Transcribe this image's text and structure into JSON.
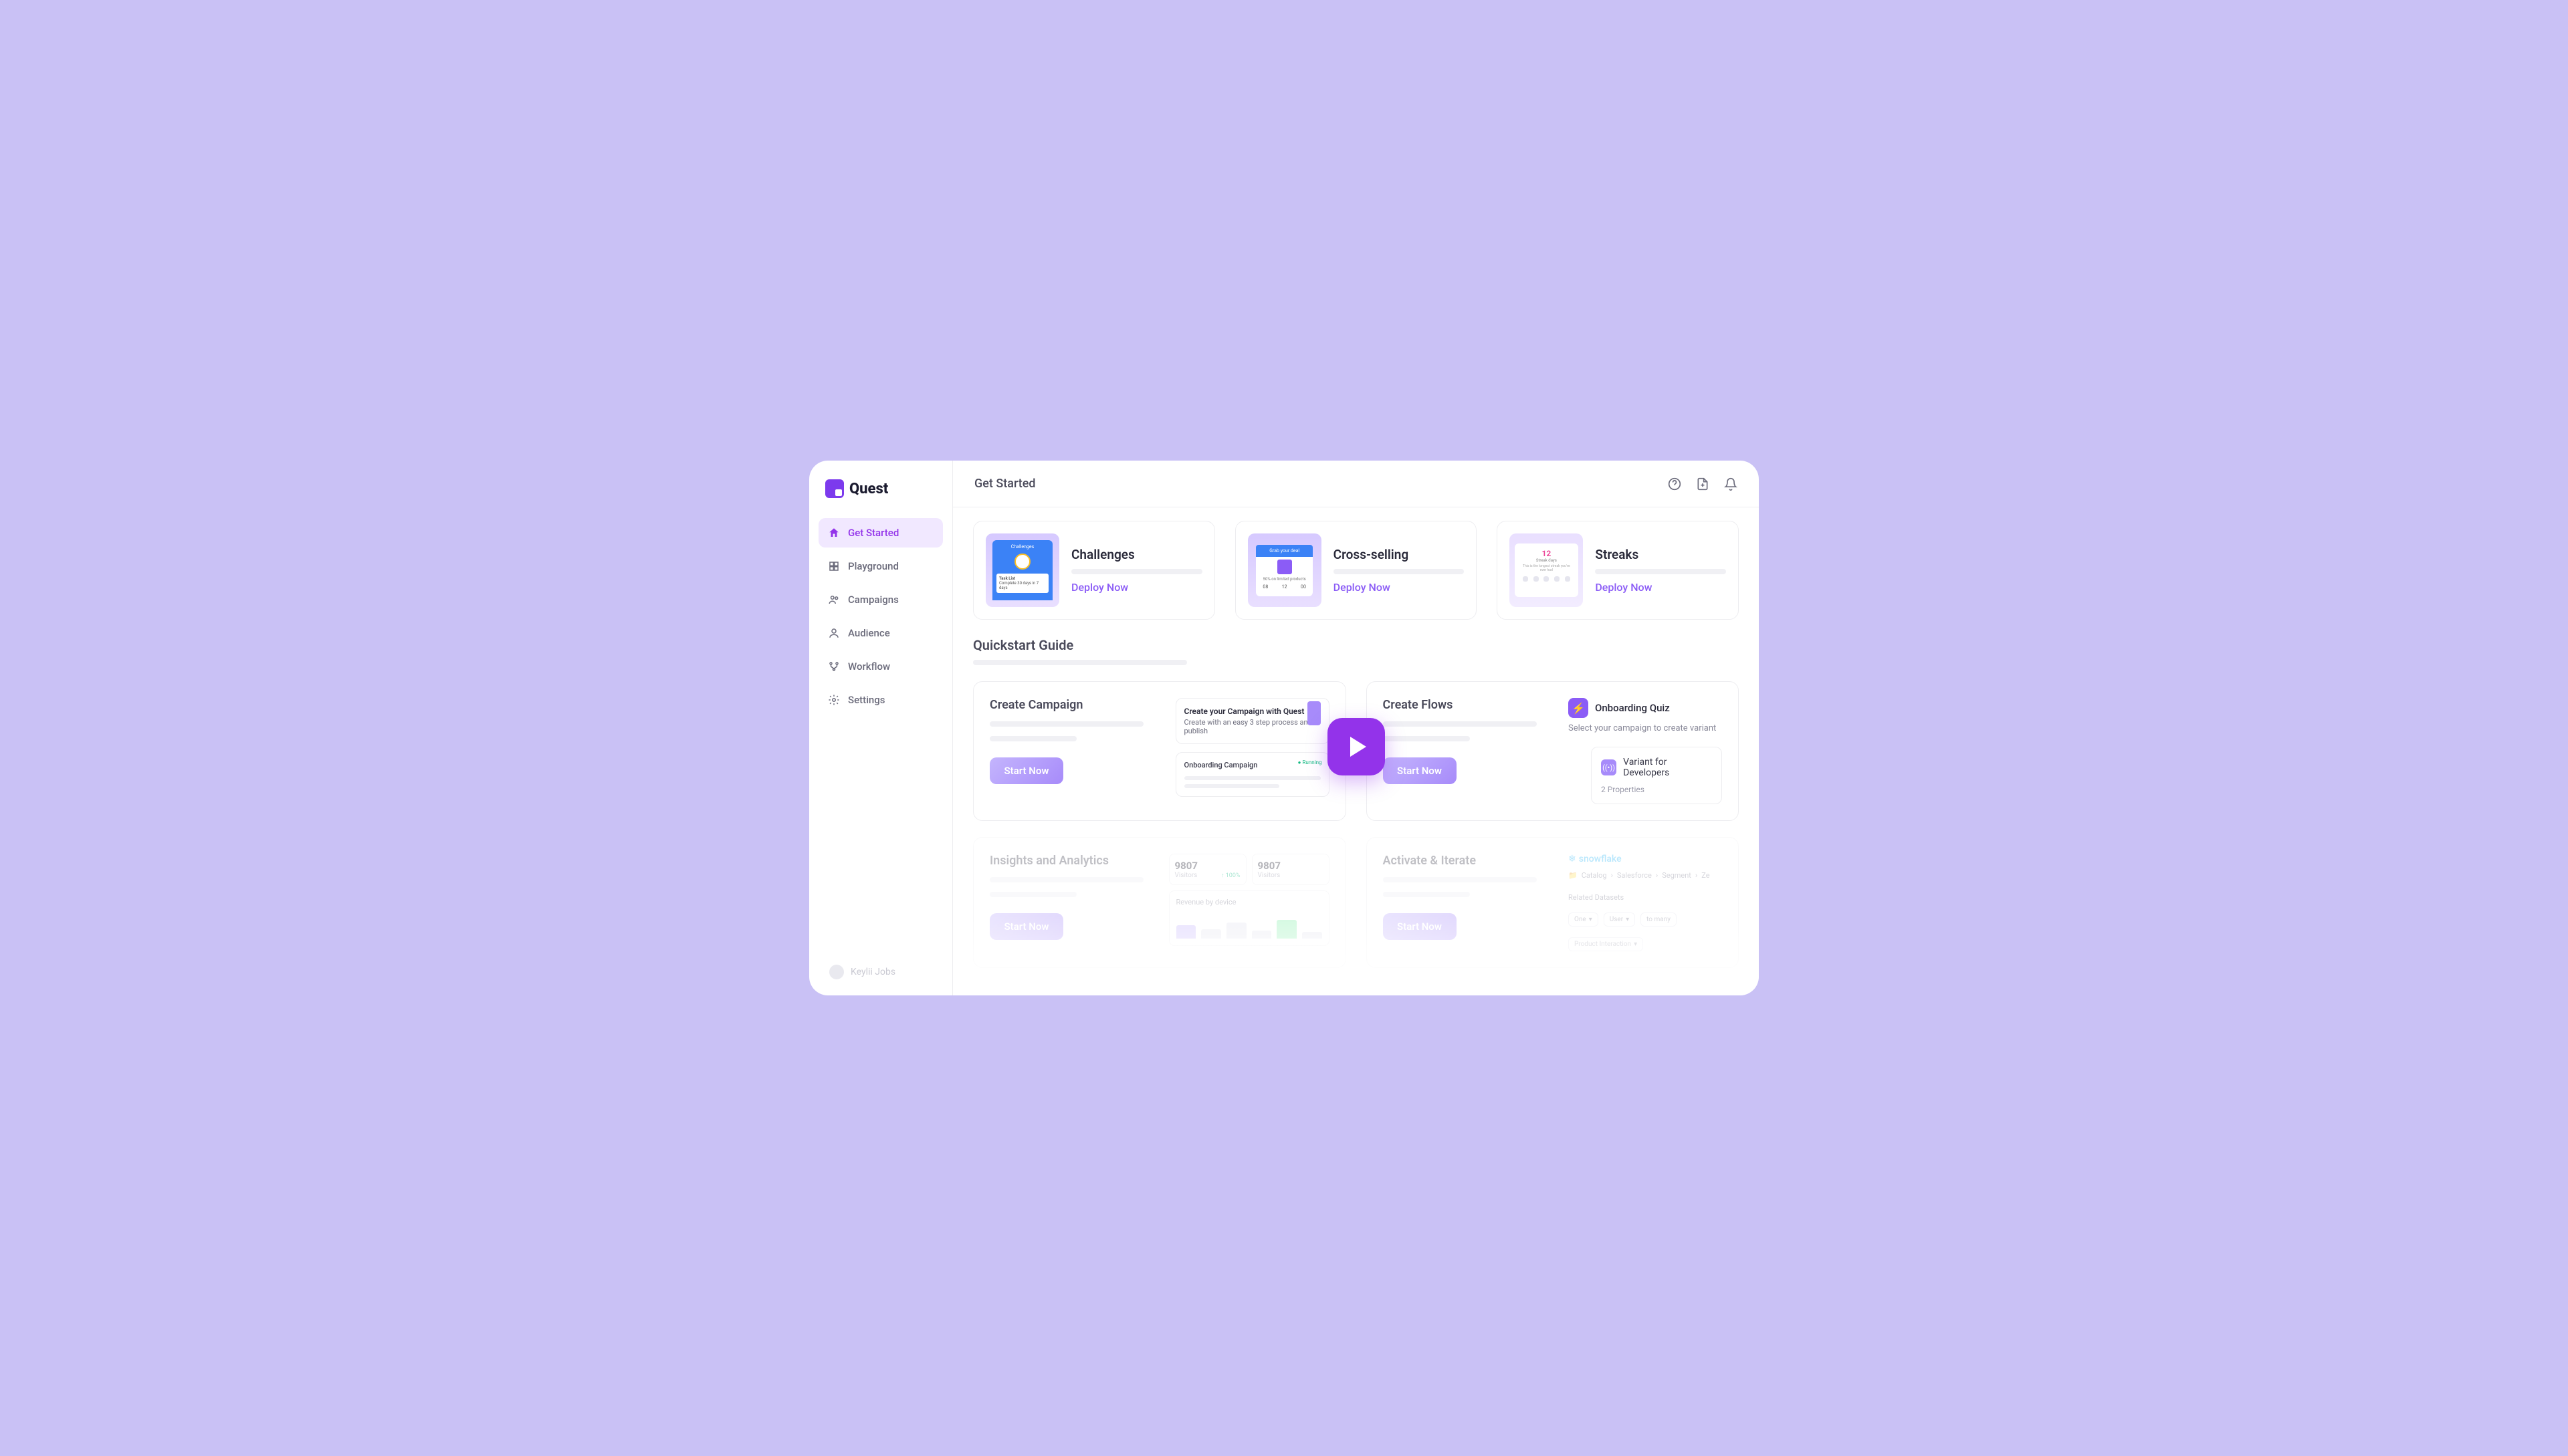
{
  "brand": "Quest",
  "header": {
    "title": "Get Started"
  },
  "nav": {
    "get_started": "Get Started",
    "playground": "Playground",
    "campaigns": "Campaigns",
    "audience": "Audience",
    "workflow": "Workflow",
    "settings": "Settings"
  },
  "user": {
    "name": "Keylii Jobs"
  },
  "cards": {
    "challenges": {
      "title": "Challenges",
      "cta": "Deploy Now",
      "thumb_label": "Challenges",
      "task_title": "Task List",
      "task_sub": "Complete 30 days in 7 days"
    },
    "cross_selling": {
      "title": "Cross-selling",
      "cta": "Deploy Now",
      "thumb_top": "Grab your deal",
      "thumb_deal": "50% on limited products",
      "t1": "08",
      "t2": "12",
      "t3": "00"
    },
    "streaks": {
      "title": "Streaks",
      "cta": "Deploy Now",
      "num": "12",
      "sub": "Streak days",
      "desc": "This is the longest streak you've ever had"
    }
  },
  "guide": {
    "title": "Quickstart Guide"
  },
  "create_campaign": {
    "title": "Create Campaign",
    "cta": "Start Now",
    "tooltip_title": "Create your Campaign with Quest",
    "tooltip_sub": "Create with an easy 3 step process and publish",
    "onboard_title": "Onboarding Campaign",
    "onboard_status": "● Running"
  },
  "create_flows": {
    "title": "Create Flows",
    "cta": "Start Now",
    "quiz_label": "Onboarding Quiz",
    "quiz_sub": "Select your campaign to create variant",
    "variant_label": "Variant for Developers",
    "variant_sub": "2 Properties"
  },
  "insights": {
    "title": "Insights and Analytics",
    "cta": "Start Now",
    "visitors": "Visitors",
    "value": "9807",
    "delta": "↑ 100%",
    "revenue_label": "Revenue by device"
  },
  "activate": {
    "title": "Activate & Iterate",
    "cta": "Start Now",
    "snowflake": "snowflake",
    "breadcrumb": {
      "b1": "Catalog",
      "b2": "Salesforce",
      "b3": "Segment",
      "b4": "Ze"
    },
    "related": "Related Datasets",
    "pills": {
      "p1": "One",
      "p2": "User",
      "p3": "to many",
      "p4": "Product Interaction"
    }
  }
}
